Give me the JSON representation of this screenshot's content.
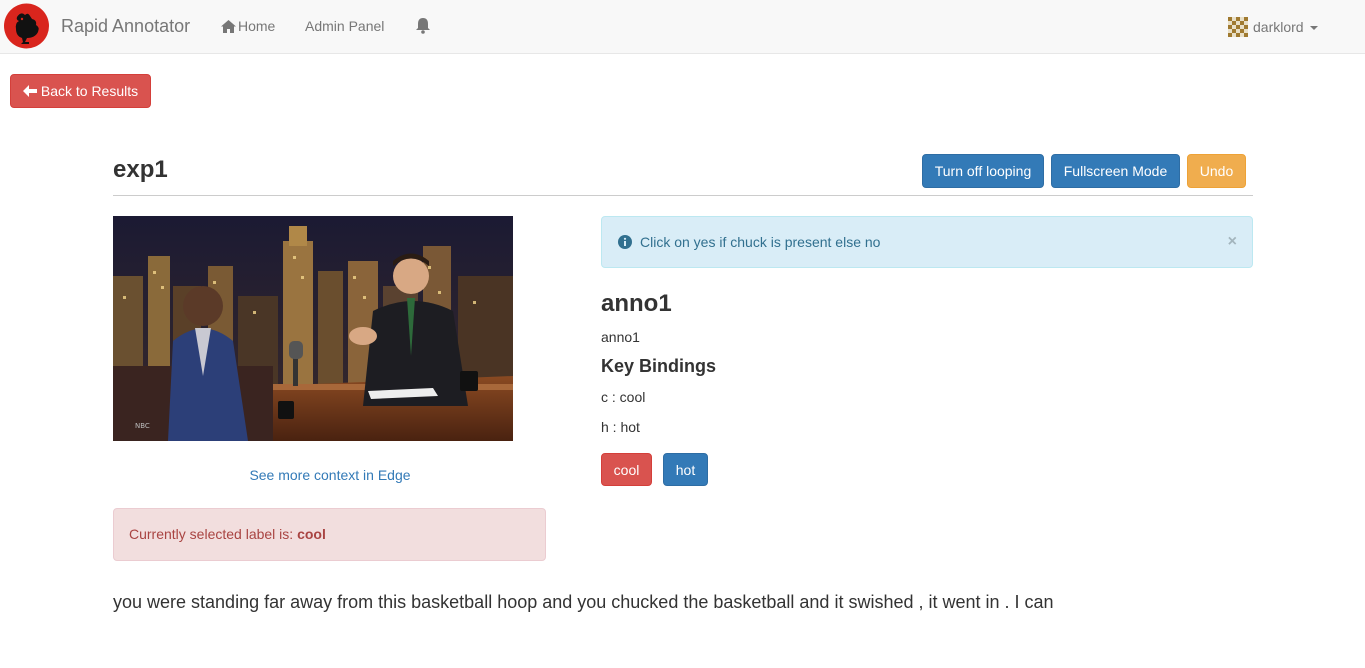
{
  "navbar": {
    "brand": "Rapid Annotator",
    "home": "Home",
    "admin": "Admin Panel",
    "user": "darklord"
  },
  "back_button": "Back to Results",
  "experiment": {
    "title": "exp1",
    "loop_button": "Turn off looping",
    "fullscreen_button": "Fullscreen Mode",
    "undo_button": "Undo"
  },
  "video": {
    "context_link": "See more context in Edge"
  },
  "selected": {
    "prefix": "Currently selected label is: ",
    "label": "cool"
  },
  "info_alert": {
    "text": "Click on yes if chuck is present else no",
    "close": "×"
  },
  "annotation": {
    "title": "anno1",
    "subtitle": "anno1",
    "key_bindings_title": "Key Bindings",
    "bindings": [
      "c : cool",
      "h : hot"
    ],
    "labels": [
      "cool",
      "hot"
    ]
  },
  "transcript": "you were standing far away from this basketball hoop and you chucked the basketball and it swished , it went in . I can",
  "colors": {
    "danger": "#d9534f",
    "primary": "#337ab7",
    "warning": "#f0ad4e",
    "info_bg": "#d9edf7"
  }
}
